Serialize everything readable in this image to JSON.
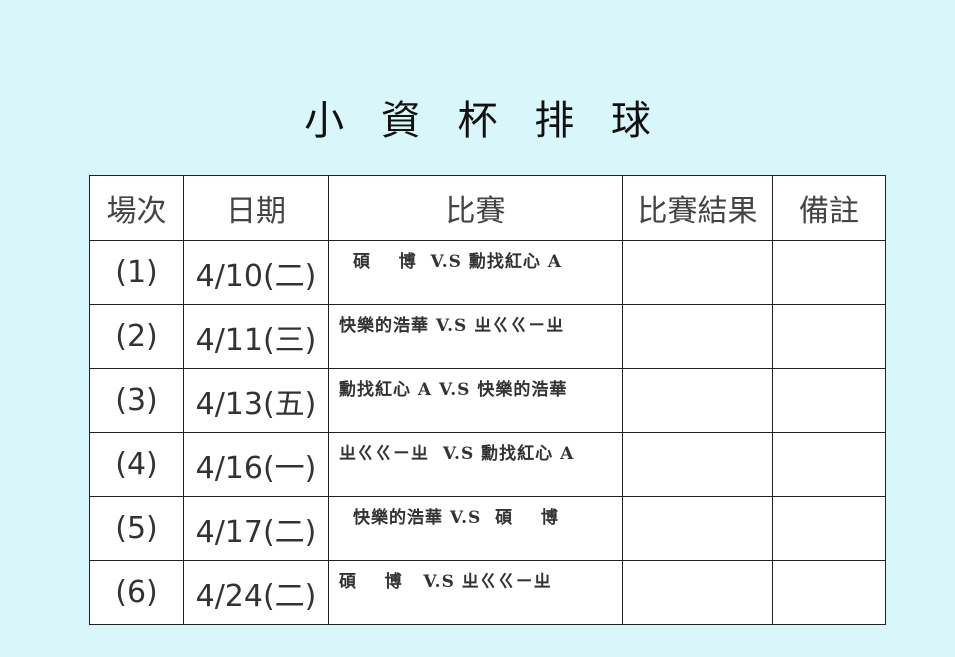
{
  "title": "小 資 杯 排 球",
  "table": {
    "headers": [
      "場次",
      "日期",
      "比賽",
      "比賽結果",
      "備註"
    ],
    "rows": [
      {
        "num": "(1)",
        "date": "4/10(二)",
        "match": "碩    博  V.S 勳找紅心 A",
        "result": "",
        "note": ""
      },
      {
        "num": "(2)",
        "date": "4/11(三)",
        "match": "快樂的浩華 V.S ㄓㄍㄍㄧㄓ",
        "result": "",
        "note": ""
      },
      {
        "num": "(3)",
        "date": "4/13(五)",
        "match": "勳找紅心 A V.S 快樂的浩華",
        "result": "",
        "note": ""
      },
      {
        "num": "(4)",
        "date": "4/16(一)",
        "match": "ㄓㄍㄍㄧㄓ  V.S 勳找紅心 A",
        "result": "",
        "note": ""
      },
      {
        "num": "(5)",
        "date": "4/17(二)",
        "match": "快樂的浩華 V.S  碩    博",
        "result": "",
        "note": ""
      },
      {
        "num": "(6)",
        "date": "4/24(二)",
        "match": "碩    博   V.S ㄓㄍㄍㄧㄓ",
        "result": "",
        "note": ""
      }
    ]
  }
}
